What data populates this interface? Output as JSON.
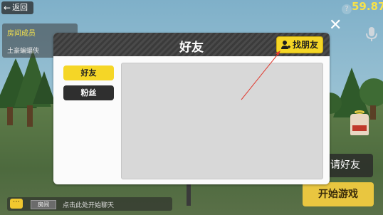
{
  "hud": {
    "back_label": "返回",
    "score": "59.87"
  },
  "room_members": {
    "title": "房间成员",
    "member_name": "土豪蝙蝠侠"
  },
  "buttons": {
    "invite_label": "请好友",
    "start_label": "开始游戏"
  },
  "chat": {
    "channel_tag": "房间",
    "hint": "点击此处开始聊天"
  },
  "modal": {
    "title": "好友",
    "find_friends_label": "找朋友",
    "tabs": [
      {
        "label": "好友",
        "selected": true
      },
      {
        "label": "粉丝",
        "selected": false
      }
    ]
  },
  "colors": {
    "accent_yellow": "#f5d626",
    "score_yellow": "#f6e24b",
    "annotation_red": "#e03a2f"
  },
  "icons": [
    "back-arrow-icon",
    "help-icon",
    "microphone-icon",
    "close-icon",
    "person-add-icon",
    "chat-icon"
  ]
}
